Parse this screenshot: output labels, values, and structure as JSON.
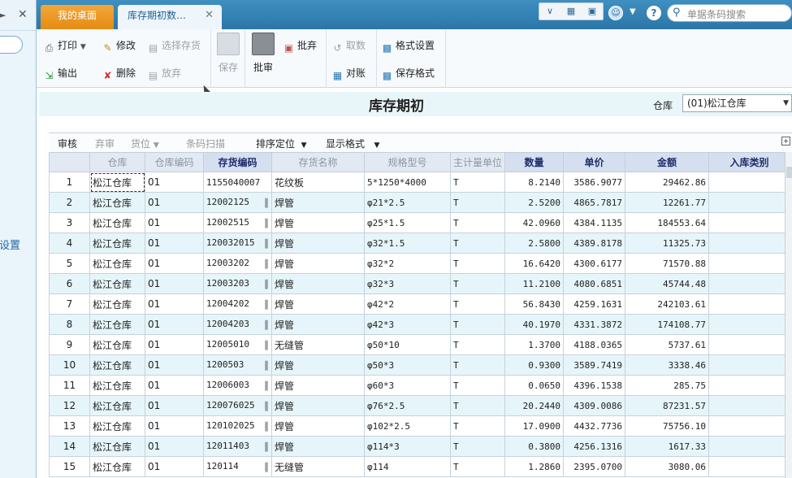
{
  "left_panel": {
    "partial_text": "设置"
  },
  "tabs": [
    {
      "label": "我的桌面"
    },
    {
      "label": "库存期初数…",
      "active": true
    }
  ],
  "topright": {
    "search_placeholder": "单据条码搜索",
    "help_label": "?"
  },
  "toolbar": {
    "print": "打印",
    "export": "输出",
    "modify": "修改",
    "delete": "删除",
    "select_stock": "选择存货",
    "abandon": "放弃",
    "save": "保存",
    "approve": "批审",
    "audit": "批审",
    "cancel_audit": "批弃",
    "fetch": "取数",
    "reconcile": "对账",
    "format_settings": "格式设置",
    "save_format": "保存格式"
  },
  "page": {
    "title": "库存期初",
    "warehouse_label": "仓库",
    "warehouse_value": "(01)松江仓库"
  },
  "grid_toolbar": {
    "audit": "审核",
    "abandon_audit": "弃审",
    "location": "货位",
    "barcode_scan": "条码扫描",
    "sort_locate": "排序定位",
    "display_format": "显示格式"
  },
  "columns": [
    "",
    "仓库",
    "仓库编码",
    "存货编码",
    "存货名称",
    "规格型号",
    "主计量单位",
    "数量",
    "单价",
    "金额",
    "入库类别"
  ],
  "rows": [
    {
      "no": "1",
      "warehouse": "松江仓库",
      "wh_code": "01",
      "item_code": "1155040007",
      "item_name": "花纹板",
      "spec": "5*1250*4000",
      "unit": "T",
      "qty": "8.2140",
      "price": "3586.9077",
      "amount": "29462.86",
      "in_type": "",
      "clip": false
    },
    {
      "no": "2",
      "warehouse": "松江仓库",
      "wh_code": "01",
      "item_code": "12002125",
      "item_name": "焊管",
      "spec": "φ21*2.5",
      "unit": "T",
      "qty": "2.5200",
      "price": "4865.7817",
      "amount": "12261.77",
      "in_type": "",
      "clip": true
    },
    {
      "no": "3",
      "warehouse": "松江仓库",
      "wh_code": "01",
      "item_code": "12002515",
      "item_name": "焊管",
      "spec": "φ25*1.5",
      "unit": "T",
      "qty": "42.0960",
      "price": "4384.1135",
      "amount": "184553.64",
      "in_type": "",
      "clip": true
    },
    {
      "no": "4",
      "warehouse": "松江仓库",
      "wh_code": "01",
      "item_code": "120032015",
      "item_name": "焊管",
      "spec": "φ32*1.5",
      "unit": "T",
      "qty": "2.5800",
      "price": "4389.8178",
      "amount": "11325.73",
      "in_type": "",
      "clip": true
    },
    {
      "no": "5",
      "warehouse": "松江仓库",
      "wh_code": "01",
      "item_code": "12003202",
      "item_name": "焊管",
      "spec": "φ32*2",
      "unit": "T",
      "qty": "16.6420",
      "price": "4300.6177",
      "amount": "71570.88",
      "in_type": "",
      "clip": true
    },
    {
      "no": "6",
      "warehouse": "松江仓库",
      "wh_code": "01",
      "item_code": "12003203",
      "item_name": "焊管",
      "spec": "φ32*3",
      "unit": "T",
      "qty": "11.2100",
      "price": "4080.6851",
      "amount": "45744.48",
      "in_type": "",
      "clip": true
    },
    {
      "no": "7",
      "warehouse": "松江仓库",
      "wh_code": "01",
      "item_code": "12004202",
      "item_name": "焊管",
      "spec": "φ42*2",
      "unit": "T",
      "qty": "56.8430",
      "price": "4259.1631",
      "amount": "242103.61",
      "in_type": "",
      "clip": true
    },
    {
      "no": "8",
      "warehouse": "松江仓库",
      "wh_code": "01",
      "item_code": "12004203",
      "item_name": "焊管",
      "spec": "φ42*3",
      "unit": "T",
      "qty": "40.1970",
      "price": "4331.3872",
      "amount": "174108.77",
      "in_type": "",
      "clip": true
    },
    {
      "no": "9",
      "warehouse": "松江仓库",
      "wh_code": "01",
      "item_code": "12005010",
      "item_name": "无缝管",
      "spec": "φ50*10",
      "unit": "T",
      "qty": "1.3700",
      "price": "4188.0365",
      "amount": "5737.61",
      "in_type": "",
      "clip": true
    },
    {
      "no": "10",
      "warehouse": "松江仓库",
      "wh_code": "01",
      "item_code": "1200503",
      "item_name": "焊管",
      "spec": "φ50*3",
      "unit": "T",
      "qty": "0.9300",
      "price": "3589.7419",
      "amount": "3338.46",
      "in_type": "",
      "clip": true
    },
    {
      "no": "11",
      "warehouse": "松江仓库",
      "wh_code": "01",
      "item_code": "12006003",
      "item_name": "焊管",
      "spec": "φ60*3",
      "unit": "T",
      "qty": "0.0650",
      "price": "4396.1538",
      "amount": "285.75",
      "in_type": "",
      "clip": true
    },
    {
      "no": "12",
      "warehouse": "松江仓库",
      "wh_code": "01",
      "item_code": "120076025",
      "item_name": "焊管",
      "spec": "φ76*2.5",
      "unit": "T",
      "qty": "20.2440",
      "price": "4309.0086",
      "amount": "87231.57",
      "in_type": "",
      "clip": true
    },
    {
      "no": "13",
      "warehouse": "松江仓库",
      "wh_code": "01",
      "item_code": "120102025",
      "item_name": "焊管",
      "spec": "φ102*2.5",
      "unit": "T",
      "qty": "17.0900",
      "price": "4432.7736",
      "amount": "75756.10",
      "in_type": "",
      "clip": true
    },
    {
      "no": "14",
      "warehouse": "松江仓库",
      "wh_code": "01",
      "item_code": "12011403",
      "item_name": "焊管",
      "spec": "φ114*3",
      "unit": "T",
      "qty": "0.3800",
      "price": "4256.1316",
      "amount": "1617.33",
      "in_type": "",
      "clip": true
    },
    {
      "no": "15",
      "warehouse": "松江仓库",
      "wh_code": "01",
      "item_code": "120114",
      "item_name": "无缝管",
      "spec": "φ114",
      "unit": "T",
      "qty": "1.2860",
      "price": "2395.0700",
      "amount": "3080.06",
      "in_type": "",
      "clip": true
    }
  ]
}
